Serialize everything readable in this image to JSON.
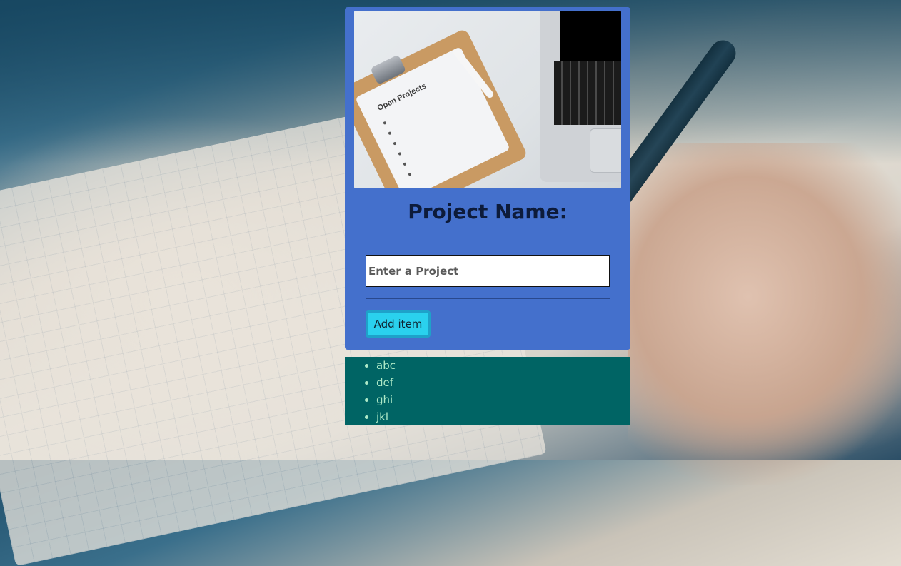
{
  "form": {
    "title": "Project Name:",
    "input_placeholder": "Enter a Project",
    "add_button_label": "Add item"
  },
  "hero_image": {
    "clipboard_heading": "Open Projects",
    "alt": "Open Projects clipboard next to laptop"
  },
  "items": [
    {
      "label": "abc"
    },
    {
      "label": "def"
    },
    {
      "label": "ghi"
    },
    {
      "label": "jkl"
    }
  ],
  "colors": {
    "card_bg": "#4470cc",
    "list_bg": "#006464",
    "button_bg": "#2ad1ee",
    "list_text": "#aee9c7"
  }
}
